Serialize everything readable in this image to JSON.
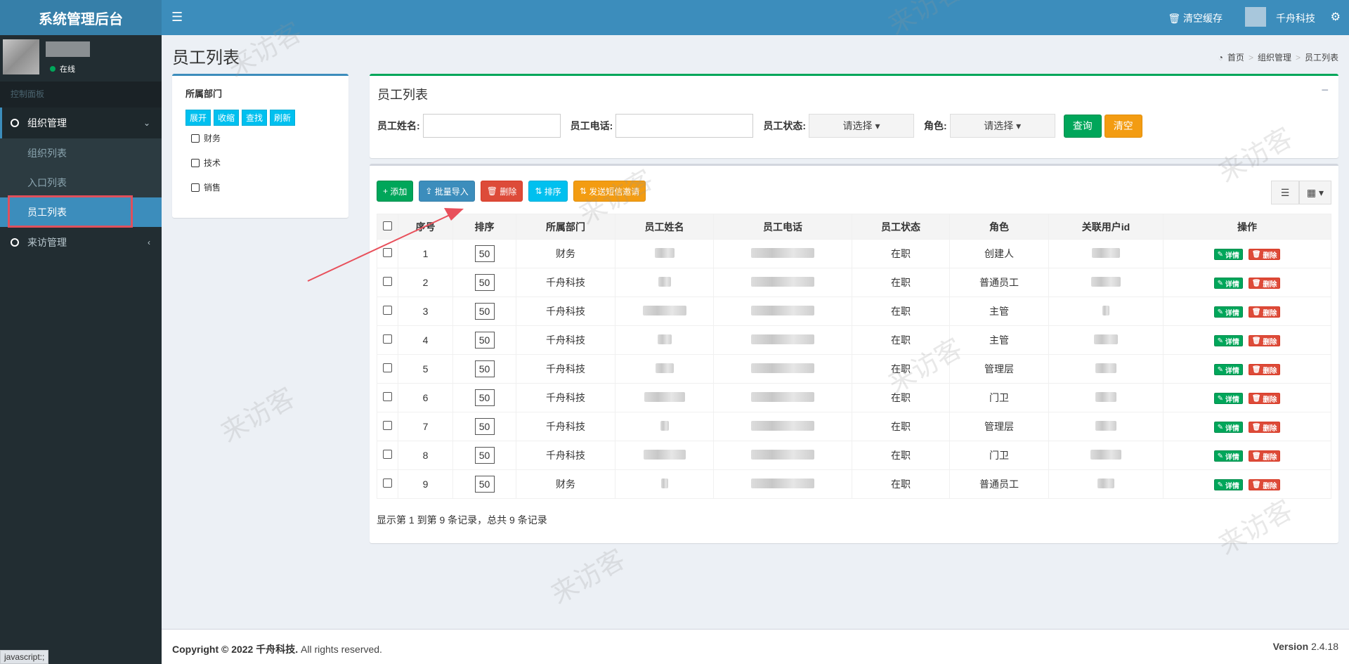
{
  "app": {
    "title": "系统管理后台",
    "user_status": "在线",
    "menu_header": "控制面板"
  },
  "sidebar": {
    "groups": [
      {
        "label": "组织管理",
        "items": [
          "组织列表",
          "入口列表",
          "员工列表"
        ]
      },
      {
        "label": "来访管理"
      }
    ]
  },
  "header": {
    "clear_cache": "清空缓存",
    "company": "千舟科技"
  },
  "page": {
    "title": "员工列表",
    "breadcrumb": [
      "首页",
      "组织管理",
      "员工列表"
    ]
  },
  "dept": {
    "title": "所属部门",
    "buttons": [
      "展开",
      "收缩",
      "查找",
      "刷新"
    ],
    "nodes": [
      "财务",
      "技术",
      "销售"
    ]
  },
  "search": {
    "title": "员工列表",
    "name_label": "员工姓名:",
    "phone_label": "员工电话:",
    "status_label": "员工状态:",
    "status_placeholder": "请选择",
    "role_label": "角色:",
    "role_placeholder": "请选择",
    "query": "查询",
    "clear": "清空"
  },
  "toolbar": {
    "add": "添加",
    "import": "批量导入",
    "delete": "删除",
    "sort": "排序",
    "sms": "发送短信邀请"
  },
  "table": {
    "columns": [
      "序号",
      "排序",
      "所属部门",
      "员工姓名",
      "员工电话",
      "员工状态",
      "角色",
      "关联用户id",
      "操作"
    ],
    "detail_label": "详情",
    "delete_label": "删除",
    "rows": [
      {
        "no": "1",
        "sort": "50",
        "dept": "财务",
        "status": "在职",
        "role": "创建人"
      },
      {
        "no": "2",
        "sort": "50",
        "dept": "千舟科技",
        "status": "在职",
        "role": "普通员工"
      },
      {
        "no": "3",
        "sort": "50",
        "dept": "千舟科技",
        "status": "在职",
        "role": "主管"
      },
      {
        "no": "4",
        "sort": "50",
        "dept": "千舟科技",
        "status": "在职",
        "role": "主管"
      },
      {
        "no": "5",
        "sort": "50",
        "dept": "千舟科技",
        "status": "在职",
        "role": "管理层"
      },
      {
        "no": "6",
        "sort": "50",
        "dept": "千舟科技",
        "status": "在职",
        "role": "门卫"
      },
      {
        "no": "7",
        "sort": "50",
        "dept": "千舟科技",
        "status": "在职",
        "role": "管理层"
      },
      {
        "no": "8",
        "sort": "50",
        "dept": "千舟科技",
        "status": "在职",
        "role": "门卫"
      },
      {
        "no": "9",
        "sort": "50",
        "dept": "财务",
        "status": "在职",
        "role": "普通员工"
      }
    ],
    "pager": "显示第 1 到第 9 条记录，总共 9 条记录"
  },
  "footer": {
    "copyright_prefix": "Copyright © 2022 千舟科技.",
    "copyright_suffix": " All rights reserved.",
    "version_label": "Version",
    "version_value": "2.4.18"
  },
  "statusbar": "javascript:;",
  "watermark": "来访客",
  "colors": {
    "sidebar": "#222d32",
    "header": "#3c8dbc",
    "accent_green": "#00a65a",
    "accent_orange": "#f39c12",
    "accent_red": "#dd4b39",
    "accent_cyan": "#00c0ef",
    "highlight": "#e0505c"
  }
}
